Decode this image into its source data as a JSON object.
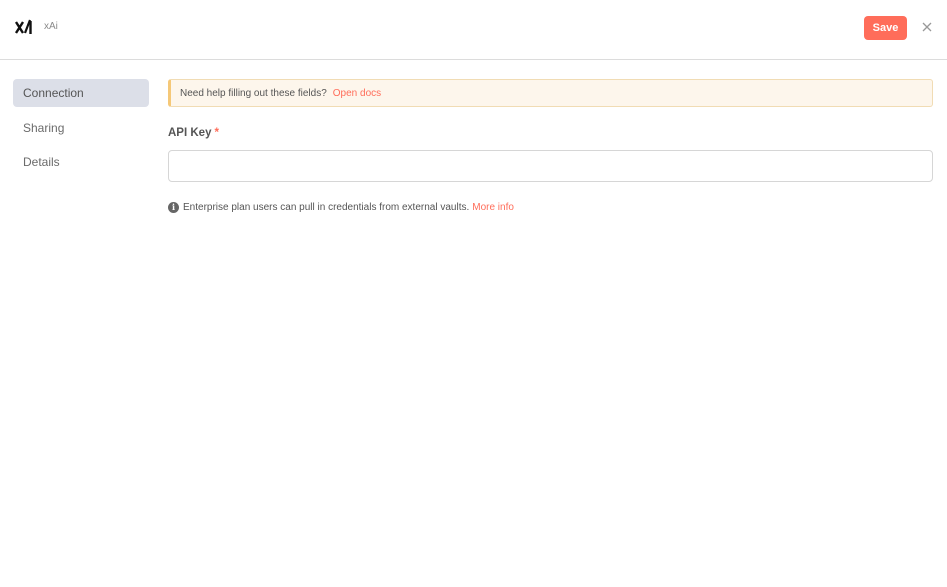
{
  "header": {
    "app_name": "xAi",
    "save_label": "Save",
    "logo_icon": "xai-logo-icon",
    "close_icon": "close-icon"
  },
  "sidebar": {
    "items": [
      {
        "label": "Connection",
        "active": true
      },
      {
        "label": "Sharing",
        "active": false
      },
      {
        "label": "Details",
        "active": false
      }
    ]
  },
  "notice": {
    "text": "Need help filling out these fields?",
    "link": "Open docs"
  },
  "form": {
    "api_key_label": "API Key",
    "required_mark": "*",
    "api_key_value": "",
    "api_key_placeholder": ""
  },
  "hint": {
    "icon": "info-icon",
    "text": "Enterprise plan users can pull in credentials from external vaults.",
    "link": "More info"
  },
  "colors": {
    "accent": "#ff6d5a",
    "active_nav_bg": "#dcdfe8",
    "notice_bg": "#fdf6ec",
    "notice_border": "#f5c878"
  }
}
